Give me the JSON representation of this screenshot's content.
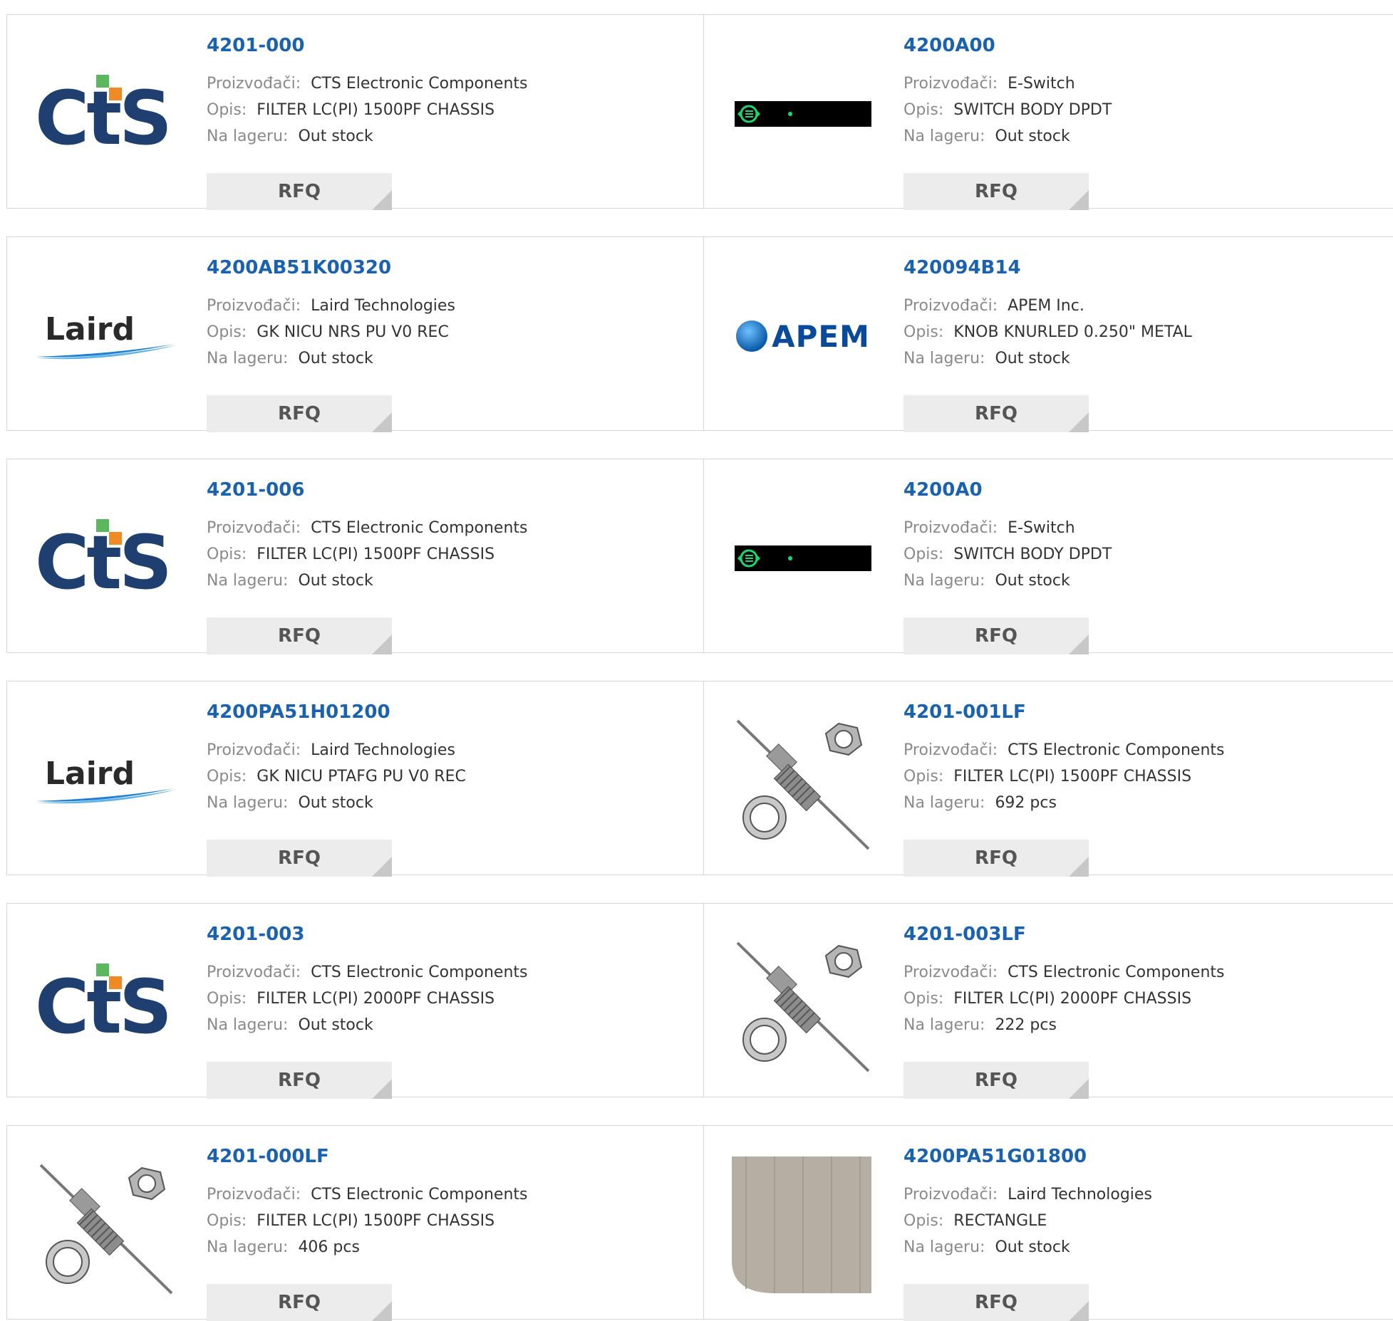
{
  "labels": {
    "manufacturer": "Proizvođači:",
    "description": "Opis:",
    "stock": "Na lageru:",
    "rfq": "RFQ"
  },
  "products": [
    {
      "part": "4201-000",
      "manufacturer": "CTS Electronic Components",
      "description": "FILTER LC(PI) 1500PF CHASSIS",
      "stock": "Out stock",
      "image": "cts-logo"
    },
    {
      "part": "4200A00",
      "manufacturer": "E-Switch",
      "description": "SWITCH BODY DPDT",
      "stock": "Out stock",
      "image": "e-switch-logo"
    },
    {
      "part": "4200AB51K00320",
      "manufacturer": "Laird Technologies",
      "description": "GK NICU NRS PU V0 REC",
      "stock": "Out stock",
      "image": "laird-logo"
    },
    {
      "part": "420094B14",
      "manufacturer": "APEM Inc.",
      "description": "KNOB KNURLED 0.250\" METAL",
      "stock": "Out stock",
      "image": "apem-logo"
    },
    {
      "part": "4201-006",
      "manufacturer": "CTS Electronic Components",
      "description": "FILTER LC(PI) 1500PF CHASSIS",
      "stock": "Out stock",
      "image": "cts-logo"
    },
    {
      "part": "4200A0",
      "manufacturer": "E-Switch",
      "description": "SWITCH BODY DPDT",
      "stock": "Out stock",
      "image": "e-switch-logo"
    },
    {
      "part": "4200PA51H01200",
      "manufacturer": "Laird Technologies",
      "description": "GK NICU PTAFG PU V0 REC",
      "stock": "Out stock",
      "image": "laird-logo"
    },
    {
      "part": "4201-001LF",
      "manufacturer": "CTS Electronic Components",
      "description": "FILTER LC(PI) 1500PF CHASSIS",
      "stock": "692 pcs",
      "image": "filter-hardware-photo"
    },
    {
      "part": "4201-003",
      "manufacturer": "CTS Electronic Components",
      "description": "FILTER LC(PI) 2000PF CHASSIS",
      "stock": "Out stock",
      "image": "cts-logo"
    },
    {
      "part": "4201-003LF",
      "manufacturer": "CTS Electronic Components",
      "description": "FILTER LC(PI) 2000PF CHASSIS",
      "stock": "222 pcs",
      "image": "filter-hardware-photo"
    },
    {
      "part": "4201-000LF",
      "manufacturer": "CTS Electronic Components",
      "description": "FILTER LC(PI) 1500PF CHASSIS",
      "stock": "406 pcs",
      "image": "filter-hardware-photo"
    },
    {
      "part": "4200PA51G01800",
      "manufacturer": "Laird Technologies",
      "description": "RECTANGLE",
      "stock": "Out stock",
      "image": "gasket-strip-photo"
    }
  ],
  "logos": {
    "cts": "CtS",
    "laird": "Laird",
    "apem": "APEM"
  },
  "colors": {
    "part_link": "#1a62b0",
    "label_gray": "#8a8a8a",
    "rfq_bg": "#ececec",
    "border": "#d6d6d6"
  }
}
